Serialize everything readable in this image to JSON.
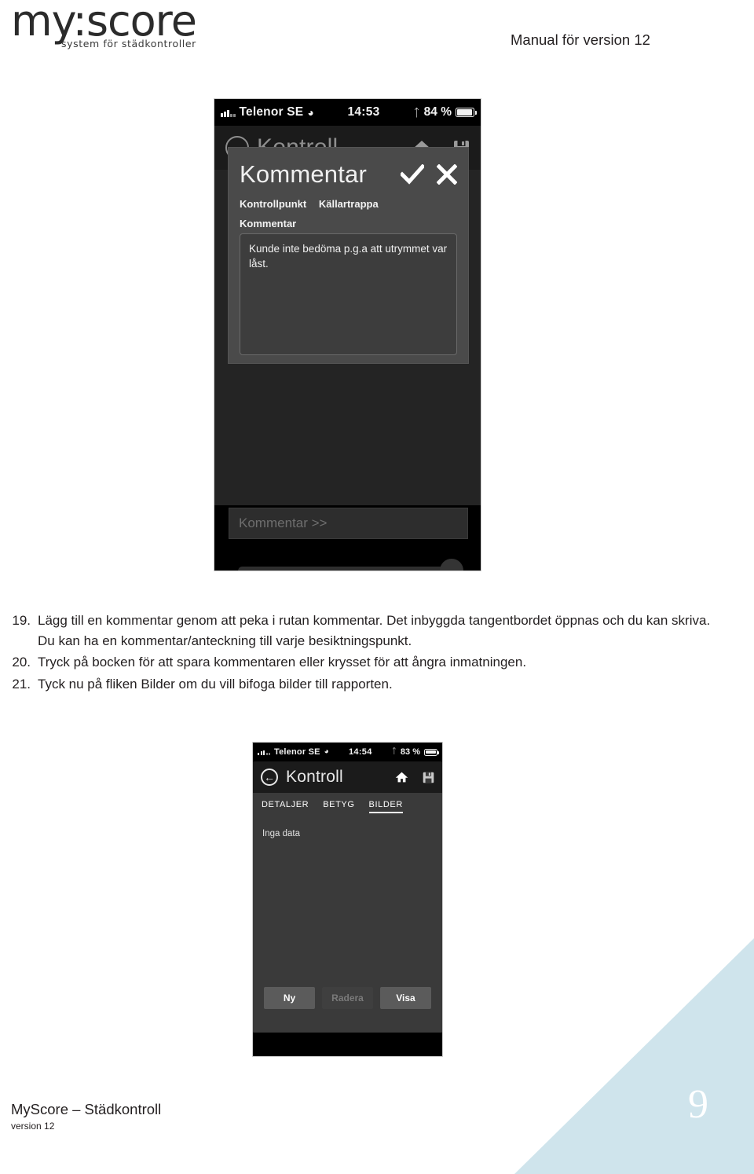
{
  "header": {
    "logo_word": "my:score",
    "logo_tagline": "system för städkontroller",
    "title": "Manual för version 12"
  },
  "phone_1": {
    "status_bar": {
      "carrier": "Telenor SE",
      "wifi_icon": "wifi-icon",
      "time": "14:53",
      "bluetooth_icon": "bluetooth-icon",
      "battery_percent": "84 %",
      "battery_icon": "battery-icon"
    },
    "nav": {
      "back_icon": "back-arrow-icon",
      "title": "Kontroll",
      "home_icon": "home-icon",
      "save_icon": "save-disk-icon"
    },
    "modal": {
      "title": "Kommentar",
      "confirm_icon": "checkmark-icon",
      "cancel_icon": "close-x-icon",
      "kontrollpunkt_label": "Kontrollpunkt",
      "kontrollpunkt_value": "Källartrappa",
      "kommentar_label": "Kommentar",
      "kommentar_text": "Kunde inte bedöma p.g.a att utrymmet var låst."
    },
    "kommentar_more": "Kommentar >>"
  },
  "phone_2": {
    "status_bar": {
      "carrier": "Telenor SE",
      "wifi_icon": "wifi-icon",
      "time": "14:54",
      "bluetooth_icon": "bluetooth-icon",
      "battery_percent": "83 %",
      "battery_icon": "battery-icon"
    },
    "nav": {
      "back_icon": "back-arrow-icon",
      "title": "Kontroll",
      "home_icon": "home-icon",
      "save_icon": "save-disk-icon"
    },
    "tabs": [
      {
        "label": "DETALJER",
        "active": false
      },
      {
        "label": "BETYG",
        "active": false
      },
      {
        "label": "BILDER",
        "active": true
      }
    ],
    "empty_state": "Inga data",
    "buttons": [
      {
        "label": "Ny",
        "disabled": false
      },
      {
        "label": "Radera",
        "disabled": true
      },
      {
        "label": "Visa",
        "disabled": false
      }
    ]
  },
  "instructions": [
    {
      "number": "19.",
      "text": "Lägg till en kommentar genom att peka i rutan kommentar. Det inbyggda tangentbordet öppnas och du kan skriva. Du kan ha en kommentar/anteckning till varje besiktningspunkt."
    },
    {
      "number": "20.",
      "text": "Tryck på bocken för att spara kommentaren eller krysset för att ångra inmatningen."
    },
    {
      "number": "21.",
      "text": "Tyck nu på fliken Bilder om du vill bifoga bilder till rapporten."
    }
  ],
  "footer": {
    "main": "MyScore – Städkontroll",
    "sub": "version 12",
    "page_number": "9"
  },
  "colors": {
    "corner_triangle": "#cfe4ec",
    "text": "#231f20",
    "phone_bg": "#000000",
    "modal_bg": "#4a4a4a"
  }
}
